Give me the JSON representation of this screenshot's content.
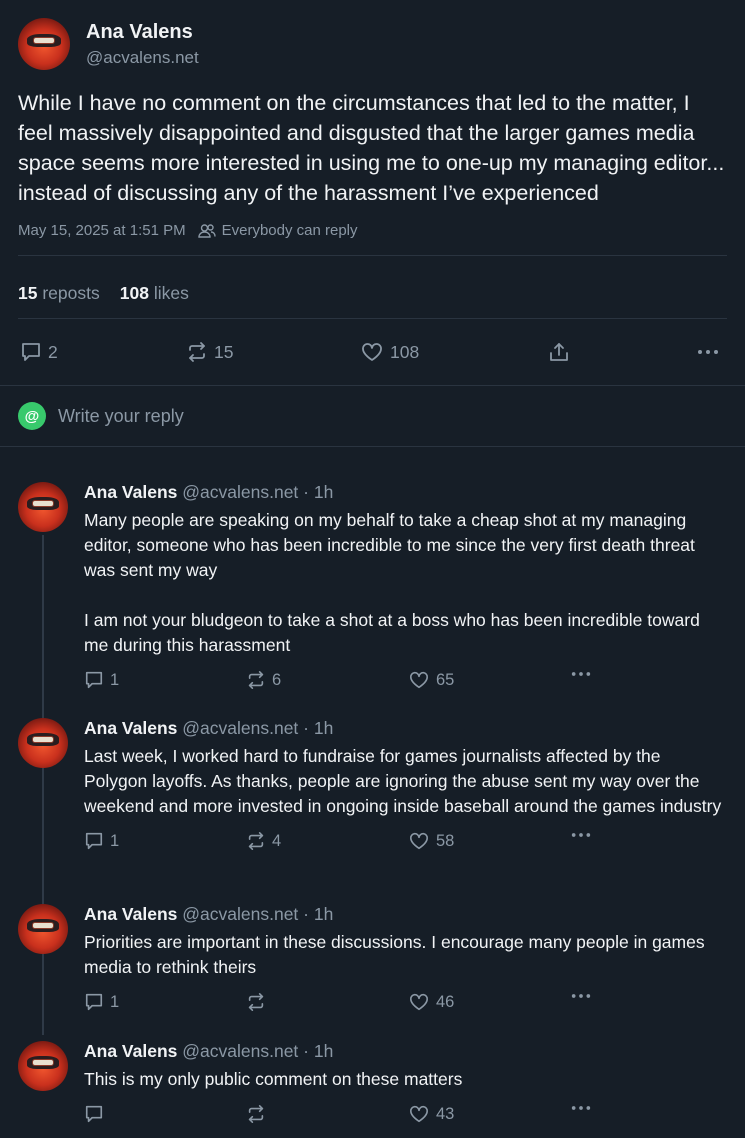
{
  "post": {
    "author": "Ana Valens",
    "handle": "@acvalens.net",
    "text": "While I have no comment on the circumstances that led to the matter, I feel massively disappointed and disgusted that the larger games media space seems more interested in using me to one-up my managing editor... instead of discussing any of the harassment I’ve experienced",
    "timestamp": "May 15, 2025 at 1:51 PM",
    "reply_setting": "Everybody can reply",
    "reposts_count": "15",
    "reposts_label": "reposts",
    "likes_count": "108",
    "likes_label": "likes",
    "actions": {
      "replies": "2",
      "reposts": "15",
      "likes": "108"
    }
  },
  "reply_box": {
    "placeholder": "Write your reply",
    "avatar_glyph": "@"
  },
  "thread": [
    {
      "author": "Ana Valens",
      "handle": "@acvalens.net",
      "time": "· 1h",
      "text": "Many people are speaking on my behalf to take a cheap shot at my managing editor, someone who has been incredible to me since the very first death threat was sent my way\n\nI am not your bludgeon to take a shot at a boss who has been incredible toward me during this harassment",
      "replies": "1",
      "reposts": "6",
      "likes": "65"
    },
    {
      "author": "Ana Valens",
      "handle": "@acvalens.net",
      "time": "· 1h",
      "text": "Last week, I worked hard to fundraise for games journalists affected by the Polygon layoffs. As thanks, people are ignoring the abuse sent my way over the weekend and more invested in ongoing inside baseball around the games industry",
      "replies": "1",
      "reposts": "4",
      "likes": "58"
    },
    {
      "author": "Ana Valens",
      "handle": "@acvalens.net",
      "time": "· 1h",
      "text": "Priorities are important in these discussions. I encourage many people in games media to rethink theirs",
      "replies": "1",
      "reposts": "",
      "likes": "46"
    },
    {
      "author": "Ana Valens",
      "handle": "@acvalens.net",
      "time": "· 1h",
      "text": "This is my only public comment on these matters",
      "replies": "",
      "reposts": "",
      "likes": "43"
    }
  ],
  "colors": {
    "background": "#161e27",
    "text": "#f1f3f5",
    "muted": "#8b98a5",
    "divider": "#2a3440",
    "reply_avatar": "#38c96c"
  }
}
